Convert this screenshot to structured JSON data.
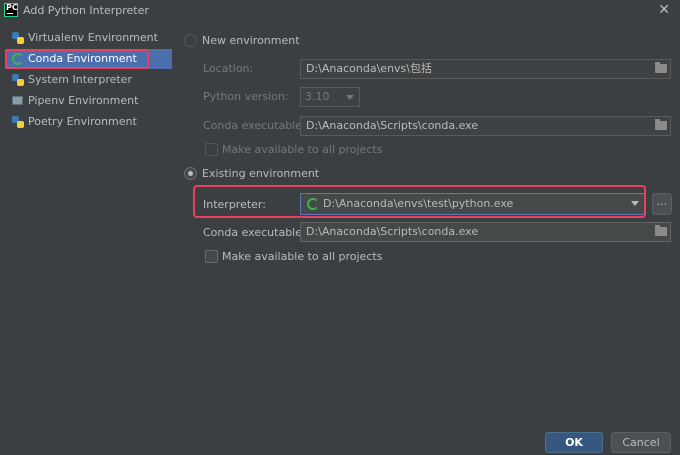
{
  "window": {
    "title": "Add Python Interpreter",
    "app_icon_text": "PC"
  },
  "sidebar": {
    "items": [
      {
        "label": "Virtualenv Environment",
        "icon": "python-icon"
      },
      {
        "label": "Conda Environment",
        "icon": "conda-icon",
        "selected": true
      },
      {
        "label": "System Interpreter",
        "icon": "python-icon"
      },
      {
        "label": "Pipenv Environment",
        "icon": "pipenv-icon"
      },
      {
        "label": "Poetry Environment",
        "icon": "python-icon"
      }
    ]
  },
  "new_env": {
    "radio_label": "New environment",
    "location_label": "Location:",
    "location_value": "D:\\Anaconda\\envs\\包括",
    "python_version_label": "Python version:",
    "python_version_value": "3.10",
    "conda_exe_label": "Conda executable:",
    "conda_exe_value": "D:\\Anaconda\\Scripts\\conda.exe",
    "make_available_label": "Make available to all projects"
  },
  "existing_env": {
    "radio_label": "Existing environment",
    "interpreter_label": "Interpreter:",
    "interpreter_value": "D:\\Anaconda\\envs\\test\\python.exe",
    "browse_label": "...",
    "conda_exe_label": "Conda executable:",
    "conda_exe_value": "D:\\Anaconda\\Scripts\\conda.exe",
    "make_available_label": "Make available to all projects"
  },
  "footer": {
    "ok_label": "OK",
    "cancel_label": "Cancel"
  },
  "colors": {
    "selection": "#4b6eaf",
    "highlight": "#e8415e",
    "ok_button": "#365880"
  }
}
